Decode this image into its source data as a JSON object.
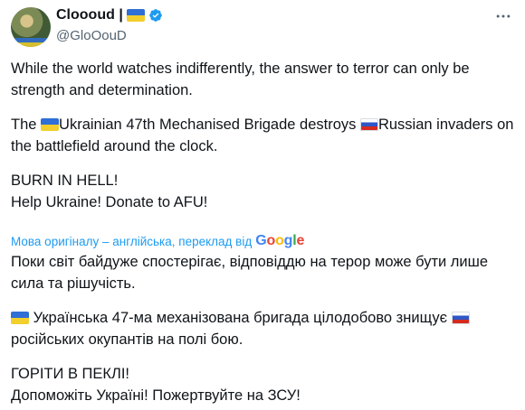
{
  "author": {
    "display_name": "Cloooud |",
    "handle": "@GloOouD",
    "verified": true
  },
  "tweet": {
    "p1": "While the world watches indifferently, the answer to terror can only be strength and determination.",
    "p2_a": "Ukrainian 47th Mechanised Brigade destroys ",
    "p2_b": "Russian invaders on the battlefield around the clock.",
    "p3_l1": "BURN IN HELL!",
    "p3_l2": "Help Ukraine! Donate to AFU!"
  },
  "translation": {
    "notice": "Мова оригіналу – англійська, переклад від",
    "provider": "Google",
    "p1": "Поки світ байдуже спостерігає, відповіддю на терор може бути лише сила та рішучість.",
    "p2_a": "Українська 47-ма механізована бригада цілодобово знищує ",
    "p2_b": "російських окупантів на полі бою.",
    "p3_l1": "ГОРІТИ В ПЕКЛІ!",
    "p3_l2": "Допоможіть Україні! Пожертвуйте на ЗСУ!"
  },
  "icons": {
    "ukraine_flag": "ukraine-flag-icon",
    "russia_flag": "russia-flag-icon",
    "verified": "verified-badge-icon",
    "more": "more-icon"
  },
  "colors": {
    "link": "#1d9bf0",
    "secondary_text": "#536471"
  }
}
